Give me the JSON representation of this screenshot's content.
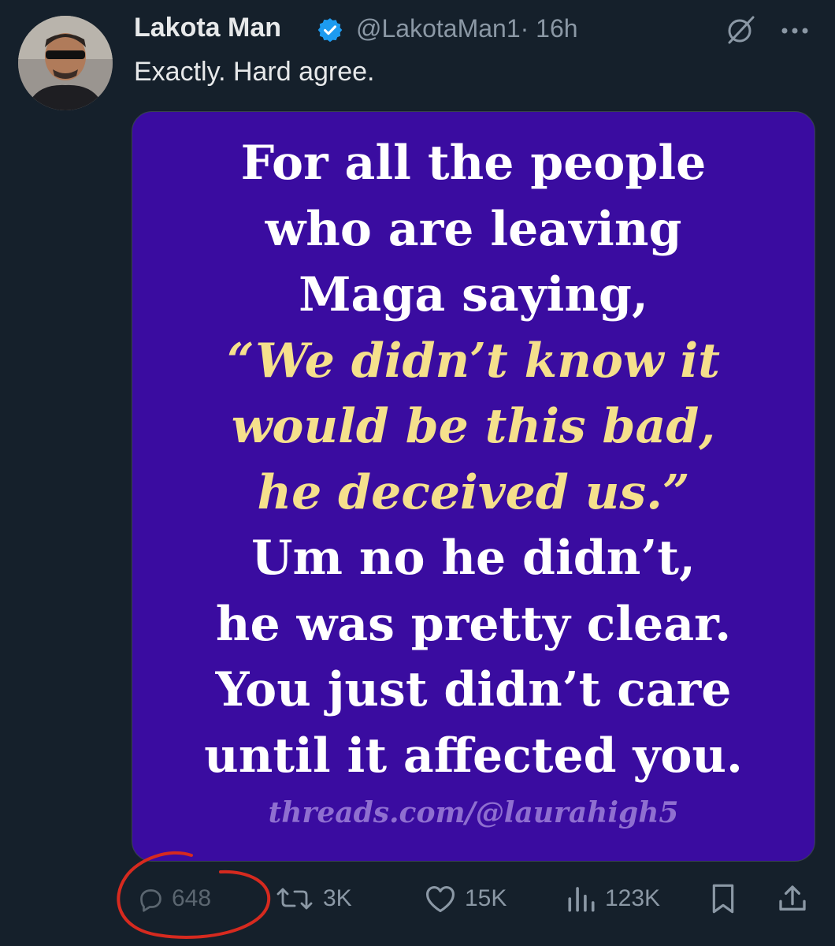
{
  "tweet": {
    "author_name": "Lakota Man",
    "handle": "@LakotaMan1",
    "separator": "·",
    "time": "16h",
    "text": "Exactly. Hard agree."
  },
  "media": {
    "lines": [
      {
        "text": "For all the people",
        "style": "white"
      },
      {
        "text": "who are leaving",
        "style": "white"
      },
      {
        "text": "Maga saying,",
        "style": "white"
      },
      {
        "text": "“We didn’t know it",
        "style": "yellow"
      },
      {
        "text": "would be this bad,",
        "style": "yellow"
      },
      {
        "text": "he deceived us.”",
        "style": "yellow"
      },
      {
        "text": "Um no he didn’t,",
        "style": "white"
      },
      {
        "text": "he was pretty clear.",
        "style": "white"
      },
      {
        "text": "You just didn’t care",
        "style": "white"
      },
      {
        "text": "until it affected you.",
        "style": "white"
      }
    ],
    "credit": "threads.com/@laurahigh5",
    "colors": {
      "background": "#3a0ca0",
      "white_text": "#ffffff",
      "yellow_text": "#f5e08c",
      "credit_text": "#8f6fd0"
    }
  },
  "actions": {
    "replies": "648",
    "reposts": "3K",
    "likes": "15K",
    "views": "123K"
  },
  "icons": [
    "verified-badge-icon",
    "grok-icon",
    "more-icon",
    "reply-icon",
    "repost-icon",
    "like-icon",
    "views-icon",
    "bookmark-icon",
    "share-icon"
  ],
  "colors": {
    "background": "#15202b",
    "text_primary": "#e7e9ea",
    "text_secondary": "#8b98a5",
    "verified_blue": "#1d9bf0",
    "annotation_red": "#d62a1f"
  }
}
